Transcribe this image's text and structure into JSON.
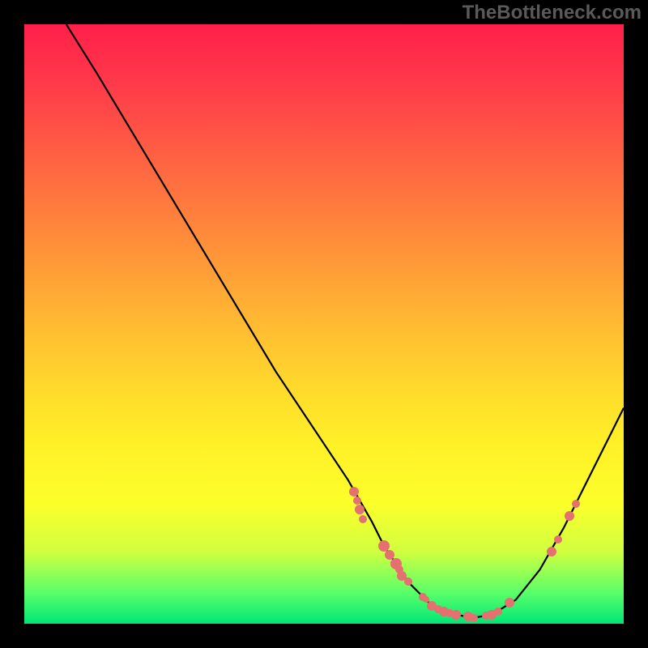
{
  "watermark": "TheBottleneck.com",
  "chart_data": {
    "type": "line",
    "title": "",
    "xlabel": "",
    "ylabel": "",
    "xlim": [
      0,
      100
    ],
    "ylim": [
      0,
      100
    ],
    "background_gradient": {
      "top": "#ff1f4a",
      "bottom": "#00e676",
      "meaning": "red high / green low"
    },
    "series": [
      {
        "name": "curve",
        "x": [
          7,
          12,
          18,
          24,
          30,
          36,
          42,
          48,
          54,
          58,
          60,
          62,
          64,
          66,
          68,
          70,
          72,
          75,
          78,
          82,
          86,
          90,
          94,
          98,
          100
        ],
        "y": [
          100,
          92,
          82,
          72,
          62,
          52,
          42,
          33,
          24,
          17,
          13,
          10,
          7,
          5,
          3,
          2,
          1.5,
          1,
          1.5,
          4,
          9,
          16,
          24,
          32,
          36
        ]
      }
    ],
    "marker_points": {
      "name": "highlighted-points",
      "color": "#e4706f",
      "points": [
        {
          "x": 55,
          "y": 22,
          "r": 6
        },
        {
          "x": 55.5,
          "y": 20.5,
          "r": 5
        },
        {
          "x": 56,
          "y": 19,
          "r": 6
        },
        {
          "x": 56.5,
          "y": 17.5,
          "r": 5
        },
        {
          "x": 60,
          "y": 13,
          "r": 7
        },
        {
          "x": 61,
          "y": 11.5,
          "r": 6
        },
        {
          "x": 62,
          "y": 10,
          "r": 7
        },
        {
          "x": 62.5,
          "y": 9,
          "r": 5
        },
        {
          "x": 63,
          "y": 8,
          "r": 6
        },
        {
          "x": 64,
          "y": 7,
          "r": 5
        },
        {
          "x": 66.5,
          "y": 4.5,
          "r": 5
        },
        {
          "x": 67,
          "y": 4,
          "r": 4
        },
        {
          "x": 68,
          "y": 3,
          "r": 6
        },
        {
          "x": 69,
          "y": 2.5,
          "r": 5
        },
        {
          "x": 70,
          "y": 2,
          "r": 6
        },
        {
          "x": 71,
          "y": 1.8,
          "r": 5
        },
        {
          "x": 72,
          "y": 1.5,
          "r": 6
        },
        {
          "x": 74,
          "y": 1.2,
          "r": 6
        },
        {
          "x": 75,
          "y": 1,
          "r": 5
        },
        {
          "x": 77,
          "y": 1.3,
          "r": 5
        },
        {
          "x": 78,
          "y": 1.5,
          "r": 6
        },
        {
          "x": 79,
          "y": 2,
          "r": 5
        },
        {
          "x": 81,
          "y": 3.5,
          "r": 6
        },
        {
          "x": 88,
          "y": 12,
          "r": 6
        },
        {
          "x": 89,
          "y": 14,
          "r": 5
        },
        {
          "x": 91,
          "y": 18,
          "r": 6
        },
        {
          "x": 92,
          "y": 20,
          "r": 5
        }
      ]
    }
  }
}
